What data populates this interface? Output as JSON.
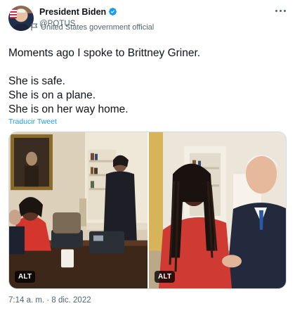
{
  "author": {
    "display_name": "President Biden",
    "handle": "@POTUS",
    "label": "United States government official",
    "verified_color": "#1d9bf0",
    "icons": [
      "verified-badge-icon",
      "government-flag-icon",
      "more-options-icon"
    ]
  },
  "tweet": {
    "line1": "Moments ago I spoke to Brittney Griner.",
    "line2": "She is safe.",
    "line3": "She is on a plane.",
    "line4": "She is on her way home.",
    "translate_label": "Traducir Tweet"
  },
  "media": {
    "photo1_alt_label": "ALT",
    "photo2_alt_label": "ALT"
  },
  "meta": {
    "timestamp": "7:14 a. m. · 8 dic. 2022"
  },
  "colors": {
    "text": "#0f1419",
    "secondary": "#536471",
    "link": "#1d9bf0",
    "border": "#cfd9de"
  }
}
